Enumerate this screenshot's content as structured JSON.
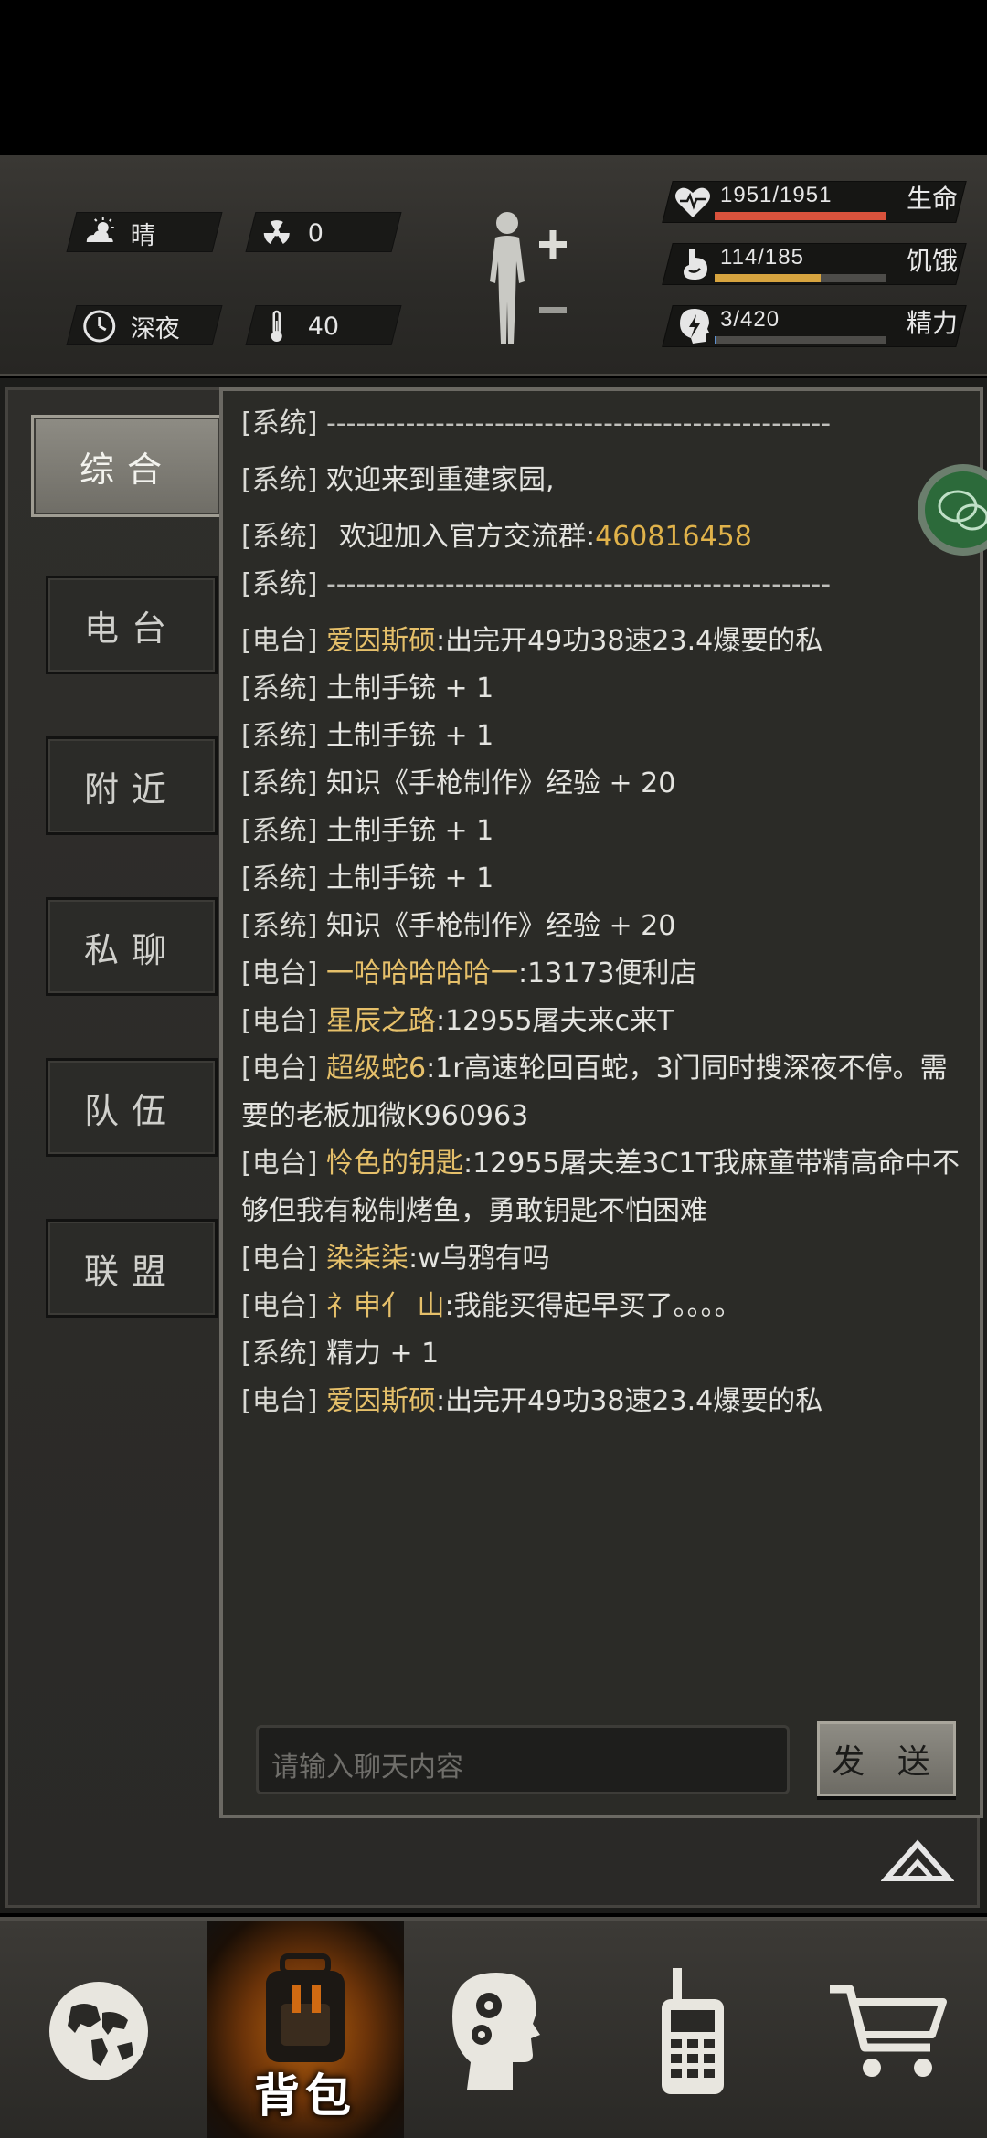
{
  "hud": {
    "weather": "晴",
    "radiation": "0",
    "time_of_day": "深夜",
    "temperature": "40",
    "stats": [
      {
        "value": "1951/1951",
        "label": "生命",
        "fill": 1.0,
        "color": "#d9523c"
      },
      {
        "value": "114/185",
        "label": "饥饿",
        "fill": 0.616,
        "color": "#d7a43f"
      },
      {
        "value": "3/420",
        "label": "精力",
        "fill": 0.007,
        "color": "#5a8fd0"
      }
    ]
  },
  "tabs": [
    {
      "label": "综合",
      "active": true
    },
    {
      "label": "电台",
      "active": false
    },
    {
      "label": "附近",
      "active": false
    },
    {
      "label": "私聊",
      "active": false
    },
    {
      "label": "队伍",
      "active": false
    },
    {
      "label": "联盟",
      "active": false
    }
  ],
  "chat": {
    "sys_tag": "[系统]",
    "radio_tag": "[电台]",
    "dashes": "---------------------------------------------------",
    "m_welcome": "欢迎来到重建家园,",
    "m_group_pre": "欢迎加入官方交流群:",
    "m_group_num": "460816458",
    "messages": [
      {
        "type": "radio",
        "who": "爱因斯硕",
        "text": ":出完开49功38速23.4爆要的私"
      },
      {
        "type": "sys",
        "text": "土制手铳 + 1"
      },
      {
        "type": "sys",
        "text": "土制手铳 + 1"
      },
      {
        "type": "sys",
        "text": "知识《手枪制作》经验 + 20"
      },
      {
        "type": "sys",
        "text": "土制手铳 + 1"
      },
      {
        "type": "sys",
        "text": "土制手铳 + 1"
      },
      {
        "type": "sys",
        "text": "知识《手枪制作》经验 + 20"
      },
      {
        "type": "radio",
        "who": "一哈哈哈哈哈一",
        "text": ":13173便利店"
      },
      {
        "type": "radio",
        "who": "星辰之路",
        "text": ":12955屠夫来c来T"
      },
      {
        "type": "radio",
        "who": "超级蛇6",
        "text": ":1r高速轮回百蛇，3门同时搜深夜不停。需要的老板加微K960963"
      },
      {
        "type": "radio",
        "who": "怜色的钥匙",
        "text": ":12955屠夫差3C1T我麻童带精高命中不够但我有秘制烤鱼，勇敢钥匙不怕困难"
      },
      {
        "type": "radio",
        "who": "染柒柒",
        "text": ":w乌鸦有吗"
      },
      {
        "type": "radio",
        "who": "礻申亻 山",
        "text": ":我能买得起早买了。。。。"
      },
      {
        "type": "sys",
        "text": "精力 + 1"
      },
      {
        "type": "radio",
        "who": "爱因斯硕",
        "text": ":出完开49功38速23.4爆要的私"
      }
    ],
    "input_placeholder": "请输入聊天内容",
    "send_label": "发 送"
  },
  "bottom_nav": {
    "items": [
      {
        "icon": "globe-icon"
      },
      {
        "icon": "backpack-icon",
        "label": "背包",
        "active": true
      },
      {
        "icon": "head-gears-icon"
      },
      {
        "icon": "walkie-talkie-icon"
      },
      {
        "icon": "shopping-cart-icon"
      }
    ]
  }
}
